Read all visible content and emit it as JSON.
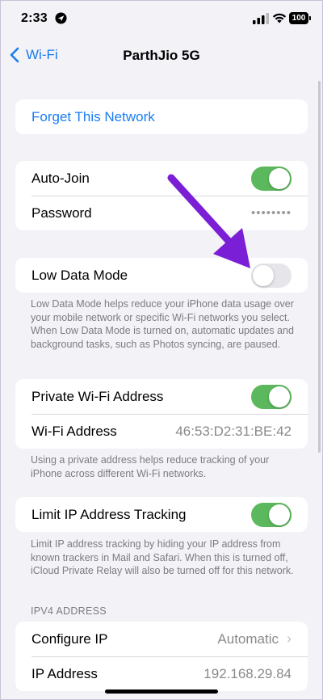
{
  "status_bar": {
    "time": "2:33",
    "battery": "100"
  },
  "nav": {
    "back_label": "Wi-Fi",
    "title": "ParthJio 5G"
  },
  "forget": {
    "label": "Forget This Network"
  },
  "network": {
    "auto_join_label": "Auto-Join",
    "auto_join": true,
    "password_label": "Password",
    "password_mask": "••••••••"
  },
  "low_data": {
    "label": "Low Data Mode",
    "enabled": false,
    "footer": "Low Data Mode helps reduce your iPhone data usage over your mobile network or specific Wi-Fi networks you select. When Low Data Mode is turned on, automatic updates and background tasks, such as Photos syncing, are paused."
  },
  "private_address": {
    "label": "Private Wi-Fi Address",
    "enabled": true,
    "address_label": "Wi-Fi Address",
    "address_value": "46:53:D2:31:BE:42",
    "footer": "Using a private address helps reduce tracking of your iPhone across different Wi-Fi networks."
  },
  "limit_ip": {
    "label": "Limit IP Address Tracking",
    "enabled": true,
    "footer": "Limit IP address tracking by hiding your IP address from known trackers in Mail and Safari. When this is turned off, iCloud Private Relay will also be turned off for this network."
  },
  "ipv4": {
    "header": "IPV4 ADDRESS",
    "configure_label": "Configure IP",
    "configure_value": "Automatic",
    "ip_label": "IP Address",
    "ip_value": "192.168.29.84"
  },
  "icons": {
    "back": "chevron-left-icon",
    "location": "location-arrow-icon",
    "signal": "cellular-signal-icon",
    "wifi": "wifi-icon",
    "disclosure": "chevron-right-icon",
    "annotation": "pointing-arrow-icon"
  },
  "colors": {
    "accent": "#1a7df0",
    "toggle_on": "#5cb85c",
    "annotation_arrow": "#7b1fd6",
    "background": "#f2f2f7"
  }
}
